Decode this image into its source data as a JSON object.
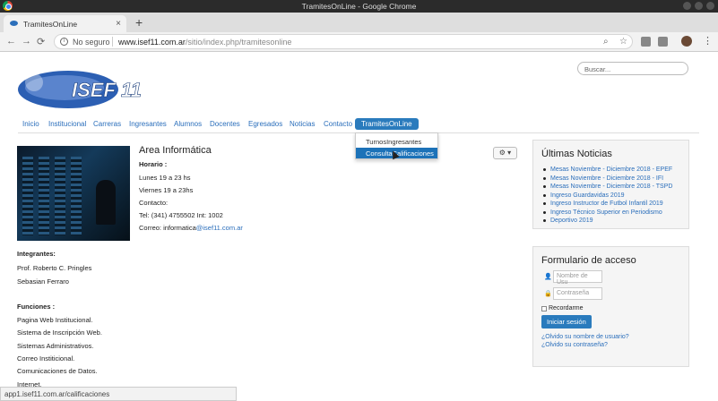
{
  "window": {
    "title": "TramitesOnLine - Google Chrome"
  },
  "tab": {
    "label": "TramitesOnLine",
    "close": "×",
    "new": "+"
  },
  "address": {
    "security": "No seguro",
    "domain": "www.isef11.com.ar",
    "path": "/sitio/index.php/tramitesonline"
  },
  "site": {
    "logo_text": "ISEF 11",
    "search_placeholder": "Buscar..."
  },
  "menu": {
    "items": [
      "Inicio",
      "Institucional",
      "Carreras",
      "Ingresantes",
      "Alumnos",
      "Docentes",
      "Egresados",
      "Noticias",
      "Contacto",
      "TramitesOnLine"
    ],
    "dropdown": [
      "TurnosIngresantes",
      "ConsultaCalificaciones"
    ]
  },
  "area": {
    "title": "Area Informática",
    "horario_label": "Horario :",
    "hours1": "Lunes 19 a 23 hs",
    "hours2": "Viernes 19 a 23hs",
    "contact_label": "Contacto:",
    "phone": "Tel: (341) 4755502 Int: 1002",
    "email_prefix": "Correo: informatica",
    "email_domain": "@isef11.com.ar"
  },
  "integrantes": {
    "title": "Integrantes:",
    "members": [
      "Prof. Roberto C. Pringles",
      "Sebasian Ferraro"
    ]
  },
  "funciones": {
    "title": "Funciones :",
    "items": [
      "Pagina Web Institucional.",
      "Sistema de Inscripción Web.",
      "Sistemas Administrativos.",
      "Correo Institicional.",
      "Comunicaciones de Datos.",
      "Internet."
    ]
  },
  "noticias": {
    "title": "Últimas Noticias",
    "items": [
      "Mesas Noviembre - Diciembre 2018 - EPEF",
      "Mesas Noviembre - Diciembre 2018 - IFI",
      "Mesas Noviembre - Diciembre 2018 - TSPD",
      "Ingreso Guardavidas 2019",
      "Ingreso Instructor de Futbol Infantil 2019",
      "Ingreso Técnico Superior en Periodismo",
      "Deportivo 2019"
    ]
  },
  "login": {
    "title": "Formulario de acceso",
    "user_placeholder": "Nombre de Usu",
    "pass_placeholder": "Contraseña",
    "remember": "Recordarme",
    "submit": "Iniciar sesión",
    "forgot_user": "¿Olvido su nombre de usuario?",
    "forgot_pass": "¿Olvido su contraseña?"
  },
  "status": {
    "url": "app1.isef11.com.ar/calificaciones"
  },
  "colors": {
    "accent": "#2a7bbd",
    "link": "#2a6ebb",
    "hover": "#1c72b8"
  }
}
